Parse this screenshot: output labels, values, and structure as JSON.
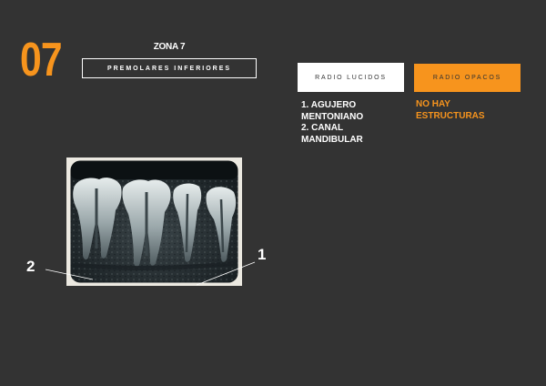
{
  "zone": {
    "number": "07",
    "label": "ZONA 7",
    "title": "PREMOLARES INFERIORES"
  },
  "tabs": {
    "lucidos": "RADIO LUCIDOS",
    "opacos": "RADIO OPACOS"
  },
  "lucidos_items": [
    "1. AGUJERO",
    "MENTONIANO",
    "2. CANAL",
    "MANDIBULAR"
  ],
  "opacos_items": [
    "NO HAY",
    "ESTRUCTURAS"
  ],
  "xray": {
    "callouts": [
      "2",
      "1"
    ]
  },
  "colors": {
    "background": "#333333",
    "accent": "#f7941d",
    "text": "#ffffff"
  }
}
